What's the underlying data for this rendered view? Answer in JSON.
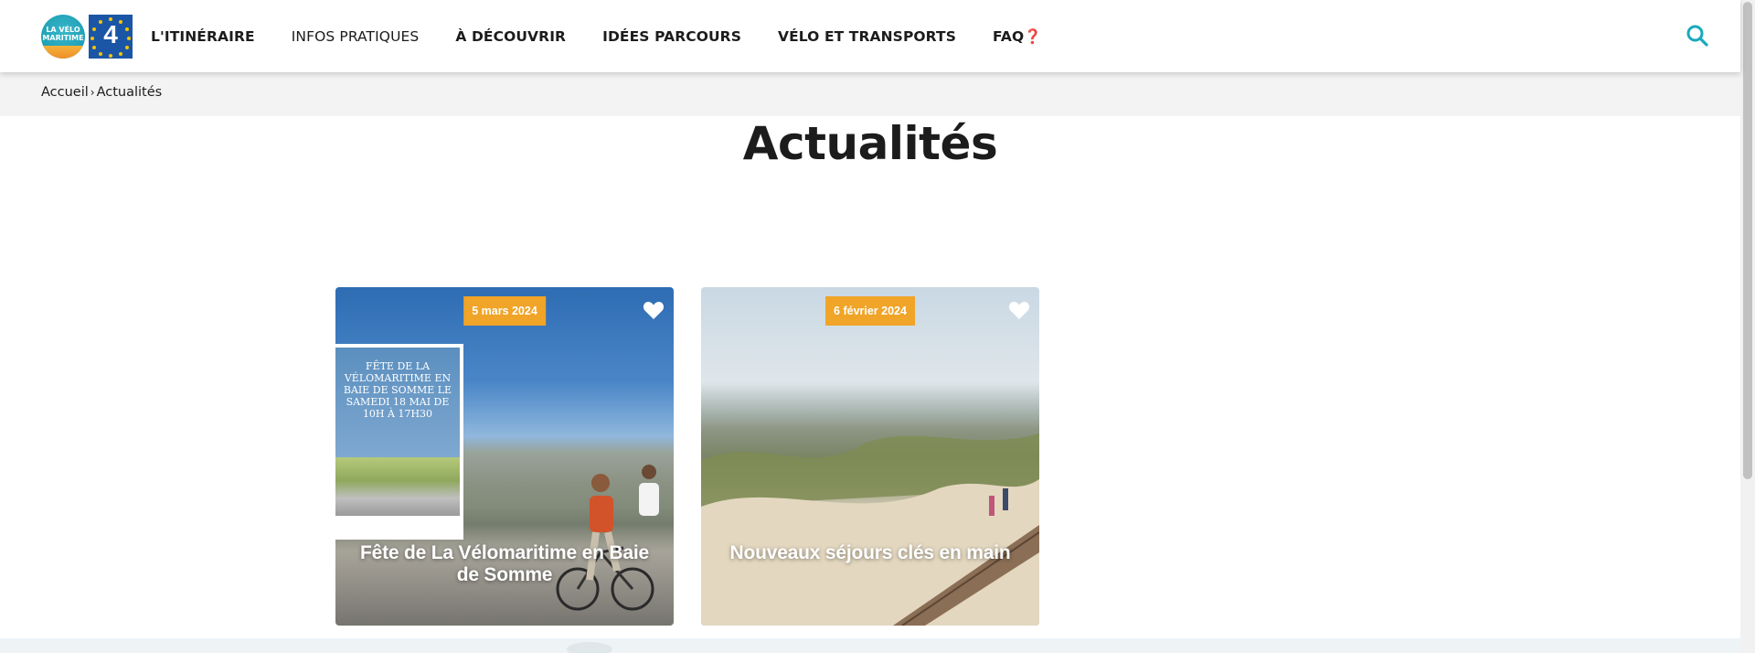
{
  "header": {
    "logo": {
      "text_line1": "LA VÉLO",
      "text_line2": "MARITIME",
      "eu_number": "4"
    },
    "nav": [
      {
        "label": "L'ITINÉRAIRE"
      },
      {
        "label": "INFOS PRATIQUES"
      },
      {
        "label": "À DÉCOUVRIR"
      },
      {
        "label": "IDÉES PARCOURS"
      },
      {
        "label": "VÉLO ET TRANSPORTS"
      },
      {
        "label": "FAQ",
        "suffix": "❓"
      }
    ],
    "search_icon": "search-icon",
    "accent_color": "#1aa9bc"
  },
  "breadcrumb": {
    "home": "Accueil",
    "separator": "›",
    "current": "Actualités"
  },
  "page": {
    "title": "Actualités"
  },
  "cards": [
    {
      "date": "5 mars 2024",
      "title": "Fête de La Vélomaritime en Baie de Somme",
      "poster_text": "FÊTE DE LA VÉLOMARITIME EN BAIE DE SOMME LE SAMEDI 18 MAI DE 10H À 17H30",
      "favorite_icon": "heart-icon"
    },
    {
      "date": "6 février 2024",
      "title": "Nouveaux séjours clés en main",
      "favorite_icon": "heart-icon"
    }
  ],
  "colors": {
    "badge": "#f0a428",
    "breadcrumb_bg": "#f3f3f3"
  }
}
